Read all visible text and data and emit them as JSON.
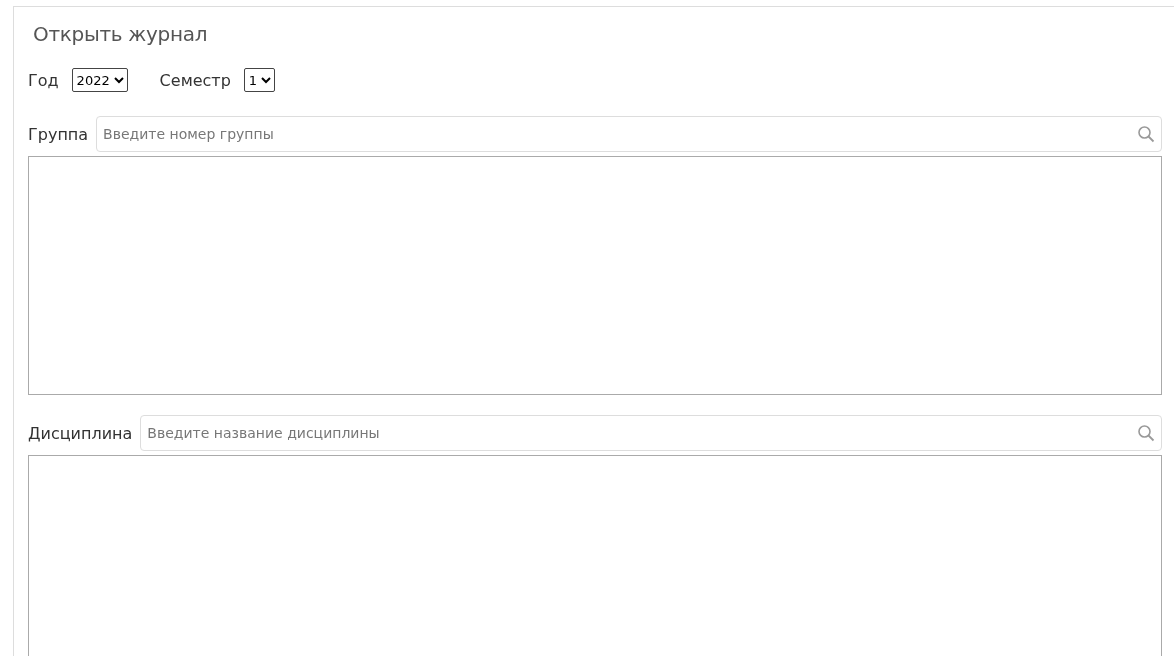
{
  "title": "Открыть журнал",
  "filters": [
    {
      "label": "Год",
      "value": "2022"
    },
    {
      "label": "Семестр",
      "value": "1"
    }
  ],
  "searches": [
    {
      "label": "Группа",
      "placeholder": "Введите номер группы"
    },
    {
      "label": "Дисциплина",
      "placeholder": "Введите название дисциплины"
    }
  ]
}
